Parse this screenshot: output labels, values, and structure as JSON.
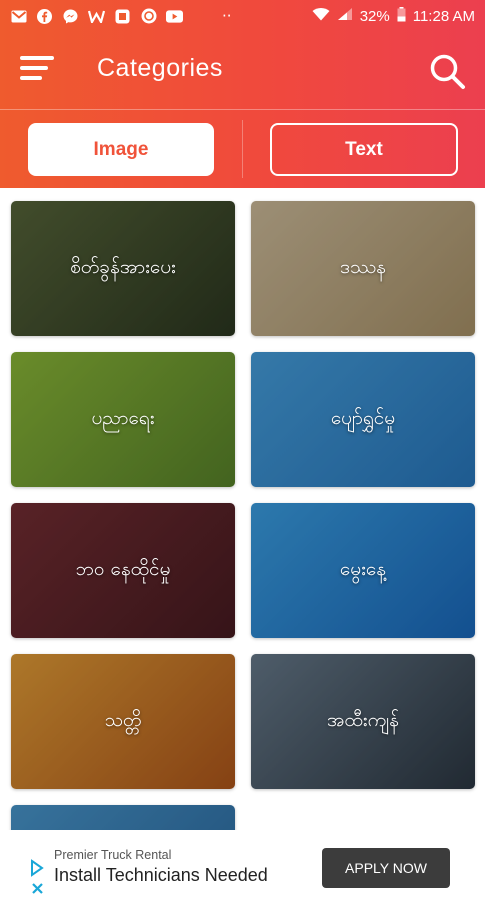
{
  "status_bar": {
    "icons": [
      "gmail-icon",
      "facebook-icon",
      "messenger-icon",
      "w-icon",
      "app-icon",
      "app2-icon",
      "youtube-icon"
    ],
    "dots": "··",
    "battery": "32%",
    "time": "11:28 AM"
  },
  "app_bar": {
    "title": "Categories"
  },
  "tabs": {
    "image": "Image",
    "text": "Text"
  },
  "categories": [
    {
      "label": "စိတ်ခွန်အားပေး",
      "colors": [
        "#5c6b3d",
        "#2e3a22"
      ]
    },
    {
      "label": "ဒဿန",
      "colors": [
        "#d9c6a3",
        "#b29a6e"
      ]
    },
    {
      "label": "ပညာရေး",
      "colors": [
        "#93c23b",
        "#5d8a2c"
      ]
    },
    {
      "label": "ပျော်ရွှင်မှု",
      "colors": [
        "#4aa8ea",
        "#2a7ec8"
      ]
    },
    {
      "label": "ဘဝ နေထိုင်မှု",
      "colors": [
        "#7b3036",
        "#4b1c22"
      ]
    },
    {
      "label": "မွေးနေ့",
      "colors": [
        "#3ea8f0",
        "#1b6fc7"
      ]
    },
    {
      "label": "သတ္တိ",
      "colors": [
        "#f0a63a",
        "#b95b1c"
      ]
    },
    {
      "label": "အထီးကျန်",
      "colors": [
        "#6d8193",
        "#2e3a46"
      ]
    },
    {
      "label": "",
      "colors": [
        "#4d9fd8",
        "#2c6ea8"
      ]
    }
  ],
  "ad": {
    "sponsor": "Premier Truck Rental",
    "headline": "Install Technicians Needed",
    "cta": "APPLY NOW",
    "colors": {
      "adchoice": "#1aa7d8"
    }
  }
}
